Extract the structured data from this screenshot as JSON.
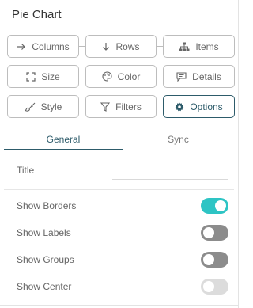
{
  "panel": {
    "title": "Pie Chart"
  },
  "buttons": {
    "columns": {
      "label": "Columns",
      "icon": "arrow-right-icon"
    },
    "rows": {
      "label": "Rows",
      "icon": "arrow-down-icon"
    },
    "items": {
      "label": "Items",
      "icon": "hierarchy-icon"
    },
    "size": {
      "label": "Size",
      "icon": "resize-icon"
    },
    "color": {
      "label": "Color",
      "icon": "palette-icon"
    },
    "details": {
      "label": "Details",
      "icon": "chat-icon"
    },
    "style": {
      "label": "Style",
      "icon": "brush-icon"
    },
    "filters": {
      "label": "Filters",
      "icon": "filter-icon"
    },
    "options": {
      "label": "Options",
      "icon": "gear-icon",
      "active": true
    }
  },
  "tabs": [
    {
      "label": "General",
      "active": true
    },
    {
      "label": "Sync",
      "active": false
    }
  ],
  "general": {
    "title_label": "Title",
    "title_value": "",
    "toggles": [
      {
        "label": "Show Borders",
        "state": "on"
      },
      {
        "label": "Show Labels",
        "state": "off"
      },
      {
        "label": "Show Groups",
        "state": "off"
      },
      {
        "label": "Show Center",
        "state": "disabled"
      }
    ]
  },
  "colors": {
    "accent": "#2d5b6a",
    "toggle_on": "#2ec4c4",
    "toggle_off": "#8c8c8c",
    "toggle_disabled": "#d9d9d9",
    "border": "#bdbdbd"
  }
}
